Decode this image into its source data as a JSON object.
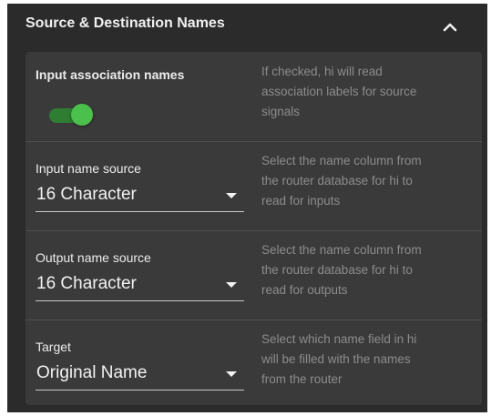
{
  "panel": {
    "title": "Source & Destination Names",
    "collapse_icon": "chevron-up-icon"
  },
  "rows": [
    {
      "label": "Input association names",
      "control": "toggle",
      "toggle_on": true,
      "help_lines": [
        "If checked, hi will read",
        "association labels for source",
        "signals"
      ]
    },
    {
      "label": "Input name source",
      "control": "select",
      "value": "16 Character",
      "help_lines": [
        "Select the name column from",
        "the router database for hi to",
        "read for inputs"
      ]
    },
    {
      "label": "Output name source",
      "control": "select",
      "value": "16 Character",
      "help_lines": [
        "Select the name column from",
        "the router database for hi to",
        "read for outputs"
      ]
    },
    {
      "label": "Target",
      "control": "select",
      "value": "Original Name",
      "help_lines": [
        "Select which name field in hi",
        "will be filled with the names",
        "from the router"
      ]
    }
  ],
  "colors": {
    "panel_bg": "#2b2b2b",
    "card_bg": "#3a3a3a",
    "toggle_on": "#4cc04c",
    "help_text": "#8c8c8c"
  }
}
